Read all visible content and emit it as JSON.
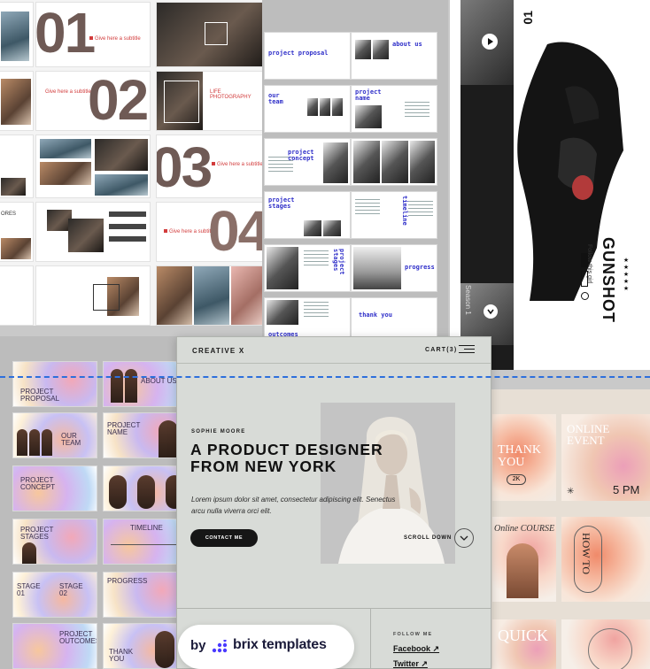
{
  "collage_top_left": {
    "numbers": [
      "01",
      "02",
      "03",
      "04"
    ],
    "slide_titles": [
      "Give here a subtitle",
      "LIFE PHOTOGRAPHY",
      "Give here a subtitle",
      "Give here a subtitle",
      "Give here a subtitle"
    ],
    "partial_label": "ORES"
  },
  "collage_top_middle": {
    "titles": [
      "project proposal",
      "about us",
      "our team",
      "project name",
      "project concept",
      "project stages",
      "timeline",
      "project stages",
      "progress",
      "outcomes",
      "thank you"
    ]
  },
  "gunshot": {
    "number": "01",
    "title": "GUNSHOT",
    "subtitle": "Follow this girl",
    "rating": "★★★★★",
    "side_label": "Season 1"
  },
  "collage_bottom_left": {
    "titles": [
      "PROJECT PROPOSAL",
      "ABOUT US",
      "OUR TEAM",
      "PROJECT NAME",
      "PROJECT CONCEPT",
      "PROJECT STAGES",
      "TIMELINE",
      "STAGE 01",
      "STAGE 02",
      "PROGRESS",
      "PROJECT OUTCOMES",
      "THANK YOU"
    ]
  },
  "collage_bottom_right": {
    "thank_you": "THANK YOU",
    "btn_2k": "2K",
    "online_event": "ONLINE EVENT",
    "time": "5 PM",
    "online_course": "Online COURSE",
    "how_to": "HOW TO",
    "quick": "QUICK"
  },
  "card": {
    "brand": "CREATIVE X",
    "cart": "CART(3)",
    "eyebrow": "SOPHIE MOORE",
    "headline": "A PRODUCT DESIGNER FROM NEW YORK",
    "lorem": "Lorem ipsum dolor sit amet, consectetur adipiscing elit. Senectus arcu nulla viverra orci elit.",
    "cta": "CONTACT ME",
    "scroll": "SCROLL DOWN",
    "follow": "FOLLOW ME",
    "social": [
      "Facebook ↗",
      "Twitter ↗"
    ]
  },
  "badge": {
    "by": "by",
    "name": "brix templates"
  },
  "colors": {
    "accent_blue": "#2f2fc9",
    "guide_blue": "#2d6fdc",
    "brand_navy": "#1b1b3a",
    "card_bg": "#d8dbd7",
    "red_accent": "#d23c3c"
  }
}
